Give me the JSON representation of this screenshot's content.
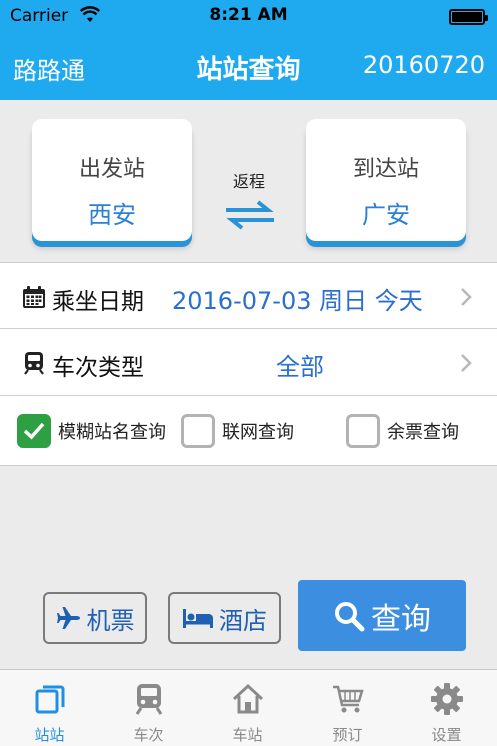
{
  "status_bar": {
    "carrier": "Carrier",
    "time": "8:21 AM"
  },
  "nav": {
    "left": "路路通",
    "title": "站站查询",
    "right": "20160720"
  },
  "stations": {
    "from_label": "出发站",
    "from_value": "西安",
    "to_label": "到达站",
    "to_value": "广安",
    "return_label": "返程"
  },
  "date_row": {
    "label": "乘坐日期",
    "value": "2016-07-03 周日 今天"
  },
  "type_row": {
    "label": "车次类型",
    "value": "全部"
  },
  "options": [
    {
      "label": "模糊站名查询",
      "checked": true
    },
    {
      "label": "联网查询",
      "checked": false
    },
    {
      "label": "余票查询",
      "checked": false
    }
  ],
  "buttons": {
    "flight": "机票",
    "hotel": "酒店",
    "query": "查询"
  },
  "tabs": [
    {
      "label": "站站",
      "icon": "stations-icon",
      "active": true
    },
    {
      "label": "车次",
      "icon": "train-icon",
      "active": false
    },
    {
      "label": "车站",
      "icon": "home-icon",
      "active": false
    },
    {
      "label": "预订",
      "icon": "cart-icon",
      "active": false
    },
    {
      "label": "设置",
      "icon": "gear-icon",
      "active": false
    }
  ],
  "colors": {
    "primary": "#1fa9ee",
    "accent": "#3b8ee0",
    "check_on": "#2ea043",
    "link": "#2a6fcf"
  }
}
